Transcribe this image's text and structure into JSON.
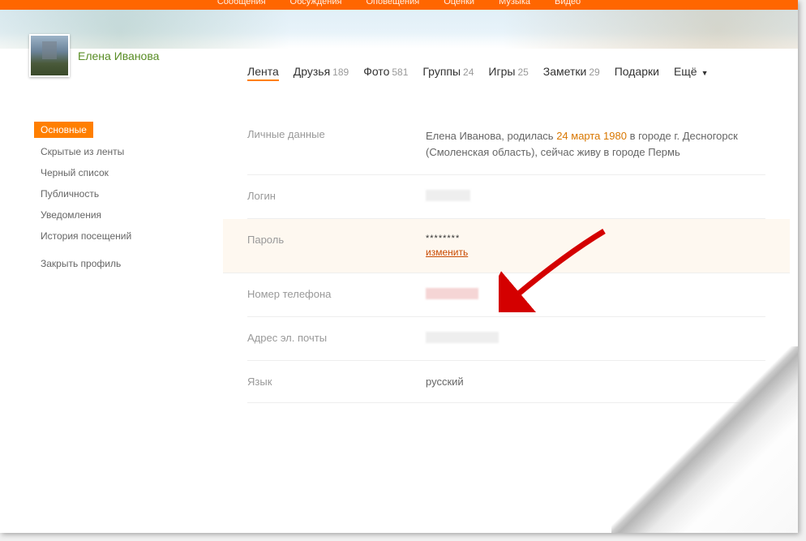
{
  "top_nav": {
    "items": [
      "Сообщения",
      "Обсуждения",
      "Оповещения",
      "Оценки",
      "Музыка",
      "Видео"
    ]
  },
  "profile": {
    "name": "Елена Иванова"
  },
  "tabs": [
    {
      "label": "Лента",
      "count": "",
      "active": true
    },
    {
      "label": "Друзья",
      "count": "189"
    },
    {
      "label": "Фото",
      "count": "581"
    },
    {
      "label": "Группы",
      "count": "24"
    },
    {
      "label": "Игры",
      "count": "25"
    },
    {
      "label": "Заметки",
      "count": "29"
    },
    {
      "label": "Подарки",
      "count": ""
    },
    {
      "label": "Ещё",
      "count": "",
      "dropdown": true
    }
  ],
  "sidebar": {
    "items": [
      {
        "label": "Основные",
        "active": true
      },
      {
        "label": "Скрытые из ленты"
      },
      {
        "label": "Черный список"
      },
      {
        "label": "Публичность"
      },
      {
        "label": "Уведомления"
      },
      {
        "label": "История посещений"
      }
    ],
    "close_profile": "Закрыть профиль"
  },
  "settings": {
    "personal": {
      "label": "Личные данные",
      "text_prefix": "Елена Иванова, родилась ",
      "date": "24 марта 1980",
      "text_suffix": " в городе г. Десногорск (Смоленская область), сейчас живу в городе Пермь"
    },
    "login": {
      "label": "Логин"
    },
    "password": {
      "label": "Пароль",
      "mask": "********",
      "change": "изменить"
    },
    "phone": {
      "label": "Номер телефона"
    },
    "email": {
      "label": "Адрес эл. почты"
    },
    "language": {
      "label": "Язык",
      "value": "русский"
    }
  }
}
